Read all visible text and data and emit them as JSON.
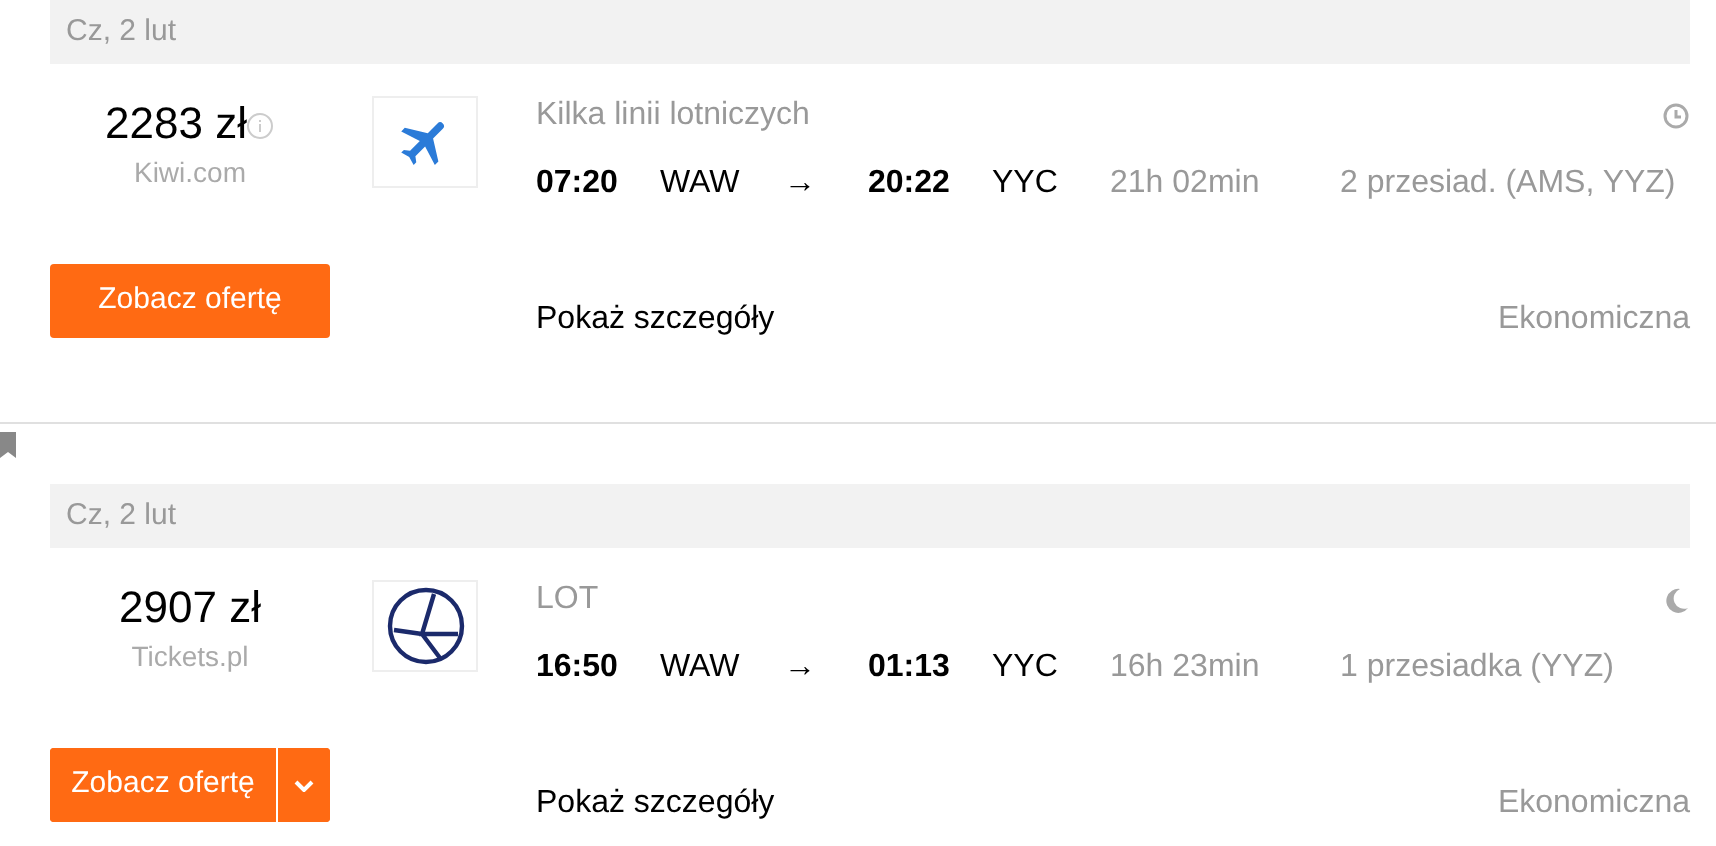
{
  "flights": [
    {
      "date": "Cz, 2 lut",
      "price": "2283 zł",
      "has_info": true,
      "provider": "Kiwi.com",
      "logo": {
        "kind": "plane"
      },
      "airline": "Kilka linii lotniczych",
      "time_icon": {
        "kind": "clock"
      },
      "departure_time": "07:20",
      "departure_airport": "WAW",
      "arrow": "→",
      "arrival_time": "20:22",
      "arrival_airport": "YYC",
      "duration": "21h 02min",
      "stops": "2 przesiad. (AMS, YYZ)",
      "button": "Zobacz ofertę",
      "has_dropdown": false,
      "details": "Pokaż szczegóły",
      "cabin": "Ekonomiczna",
      "bookmarked": false
    },
    {
      "date": "Cz, 2 lut",
      "price": "2907 zł",
      "has_info": false,
      "provider": "Tickets.pl",
      "logo": {
        "kind": "lot"
      },
      "airline": "LOT",
      "time_icon": {
        "kind": "moon"
      },
      "departure_time": "16:50",
      "departure_airport": "WAW",
      "arrow": "→",
      "arrival_time": "01:13",
      "arrival_airport": "YYC",
      "duration": "16h 23min",
      "stops": "1 przesiadka (YYZ)",
      "button": "Zobacz ofertę",
      "has_dropdown": true,
      "details": "Pokaż szczegóły",
      "cabin": "Ekonomiczna",
      "bookmarked": true
    }
  ]
}
